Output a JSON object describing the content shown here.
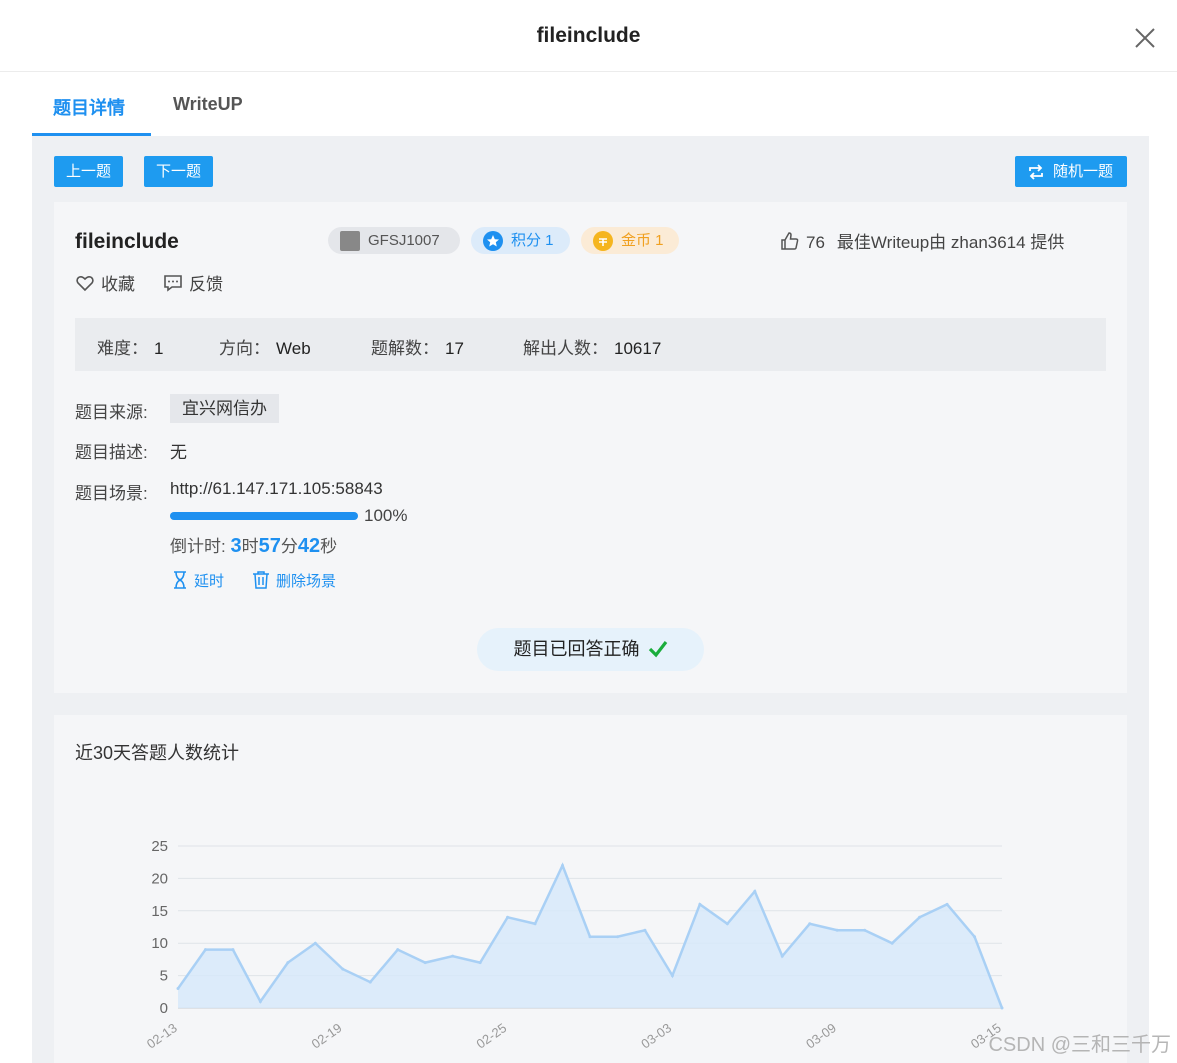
{
  "window": {
    "title": "fileinclude"
  },
  "tabs": [
    {
      "label": "题目详情",
      "active": true
    },
    {
      "label": "WriteUP",
      "active": false
    }
  ],
  "toolbar": {
    "prev_label": "上一题",
    "next_label": "下一题",
    "random_label": "随机一题"
  },
  "challenge": {
    "name": "fileinclude",
    "id_badge": "GFSJ1007",
    "points_badge": "积分 1",
    "coins_badge": "金币 1",
    "likes": "76",
    "best_writeup": "最佳Writeup由 zhan3614 提供",
    "favorite_label": "收藏",
    "feedback_label": "反馈"
  },
  "stats": {
    "difficulty_label": "难度：",
    "difficulty": "1",
    "direction_label": "方向：",
    "direction": "Web",
    "solutions_label": "题解数：",
    "solutions": "17",
    "solvers_label": "解出人数：",
    "solvers": "10617"
  },
  "details": {
    "source_label": "题目来源:",
    "source": "宜兴网信办",
    "description_label": "题目描述:",
    "description": "无",
    "scene_label": "题目场景:",
    "scene_url": "http://61.147.171.105:58843",
    "progress": 100,
    "progress_text": "100%",
    "countdown_label": "倒计时: ",
    "hours": "3",
    "hours_unit": "时",
    "minutes": "57",
    "minutes_unit": "分",
    "seconds": "42",
    "seconds_unit": "秒",
    "extend_label": "延时",
    "delete_label": "删除场景",
    "solved_text": "题目已回答正确"
  },
  "chart_data": {
    "type": "area",
    "title": "近30天答题人数统计",
    "x": [
      "02-13",
      "02-14",
      "02-15",
      "02-16",
      "02-17",
      "02-18",
      "02-19",
      "02-20",
      "02-21",
      "02-22",
      "02-23",
      "02-24",
      "02-25",
      "02-26",
      "02-27",
      "02-28",
      "03-01",
      "03-02",
      "03-03",
      "03-04",
      "03-05",
      "03-06",
      "03-07",
      "03-08",
      "03-09",
      "03-10",
      "03-11",
      "03-12",
      "03-13",
      "03-14",
      "03-15"
    ],
    "xtick_labels": [
      "02-13",
      "02-19",
      "02-25",
      "03-03",
      "03-09",
      "03-15"
    ],
    "values": [
      3,
      9,
      9,
      1,
      7,
      10,
      6,
      4,
      9,
      7,
      8,
      7,
      14,
      13,
      22,
      11,
      11,
      12,
      5,
      16,
      13,
      18,
      8,
      13,
      12,
      12,
      10,
      14,
      16,
      11,
      0
    ],
    "yticks": [
      0,
      5,
      10,
      15,
      20,
      25
    ],
    "ylim": [
      0,
      25
    ],
    "grid": true,
    "line_color": "#a9d0f5",
    "fill_color": "#d6e8fa"
  },
  "watermark": "CSDN @三和三千万",
  "colors": {
    "accent": "#1e90f0",
    "success": "#1aad3b",
    "coin": "#f0a020"
  }
}
